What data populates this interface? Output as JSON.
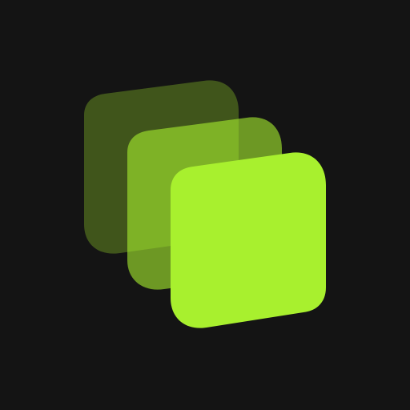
{
  "icon": {
    "name": "stacked-layers-icon",
    "background": "#141414",
    "layers": [
      {
        "name": "back-layer",
        "color": "#a8f02e",
        "opacity": 0.3
      },
      {
        "name": "middle-layer",
        "color": "#a8f02e",
        "opacity": 0.6
      },
      {
        "name": "front-layer",
        "color": "#a8f02e",
        "opacity": 1.0
      }
    ]
  }
}
